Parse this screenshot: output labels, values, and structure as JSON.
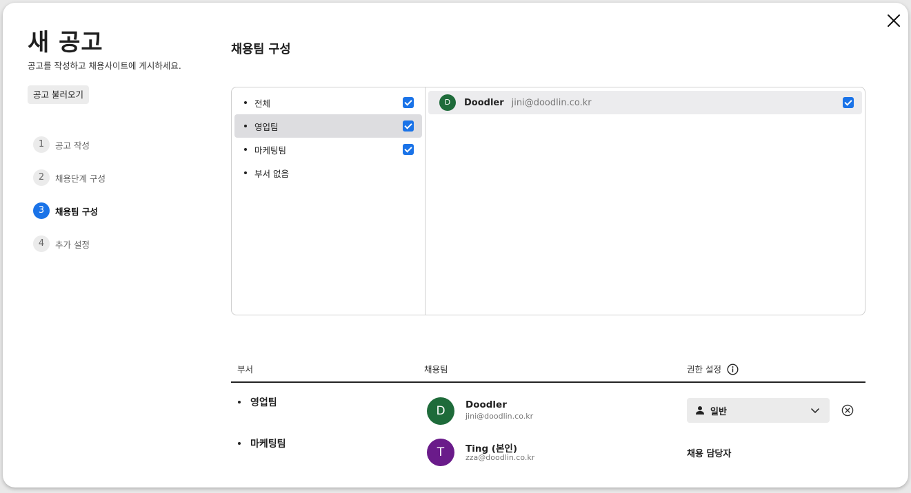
{
  "page": {
    "title": "새 공고",
    "subtitle": "공고를 작성하고 채용사이트에 게시하세요.",
    "load_button": "공고 불러오기"
  },
  "steps": [
    {
      "num": "1",
      "label": "공고 작성",
      "active": false
    },
    {
      "num": "2",
      "label": "채용단계 구성",
      "active": false
    },
    {
      "num": "3",
      "label": "채용팀 구성",
      "active": true
    },
    {
      "num": "4",
      "label": "추가 설정",
      "active": false
    }
  ],
  "section": {
    "title": "채용팀 구성"
  },
  "departments": [
    {
      "label": "전체",
      "checked": true,
      "selected": false
    },
    {
      "label": "영업팀",
      "checked": true,
      "selected": true
    },
    {
      "label": "마케팅팀",
      "checked": true,
      "selected": false
    },
    {
      "label": "부서 없음",
      "checked": false,
      "selected": false
    }
  ],
  "members": [
    {
      "initial": "D",
      "name": "Doodler",
      "email": "jini@doodlin.co.kr",
      "checked": true,
      "color": "#1e6b3a"
    }
  ],
  "table": {
    "headers": {
      "dept": "부서",
      "team": "채용팀",
      "permission": "권한 설정"
    },
    "rows": [
      {
        "dept": "영업팀",
        "initial": "D",
        "name": "Doodler",
        "email": "jini@doodlin.co.kr",
        "avatar_color": "#1e6b3a",
        "role": "일반",
        "editable": true
      },
      {
        "dept": "마케팅팀",
        "initial": "T",
        "name": "Ting (본인)",
        "email": "zza@doodlin.co.kr",
        "avatar_color": "#6a1b8a",
        "role": "채용 담당자",
        "editable": false
      }
    ]
  },
  "icons": {
    "close": "close-icon",
    "info": "info-icon",
    "person": "person-icon",
    "chevron": "chevron-down-icon",
    "remove": "remove-circle-icon"
  }
}
